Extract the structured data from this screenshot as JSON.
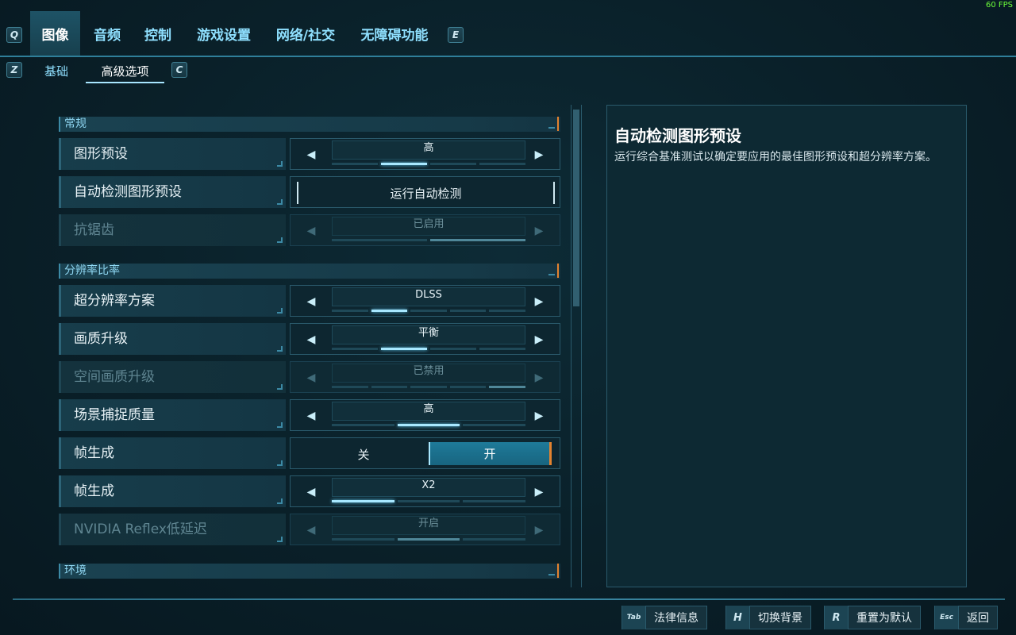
{
  "fps": "60 FPS",
  "top_tabs": {
    "left_key": "Q",
    "right_key": "E",
    "items": [
      "图像",
      "音频",
      "控制",
      "游戏设置",
      "网络/社交",
      "无障碍功能"
    ]
  },
  "sub_tabs": {
    "left_key": "Z",
    "right_key": "C",
    "items": [
      "基础",
      "高级选项"
    ]
  },
  "sections": {
    "general": "常规",
    "resolution": "分辨率比率",
    "environment": "环境"
  },
  "settings": {
    "graphics_preset": {
      "label": "图形预设",
      "value": "高"
    },
    "auto_detect": {
      "label": "自动检测图形预设",
      "button": "运行自动检测"
    },
    "anti_aliasing": {
      "label": "抗锯齿",
      "value": "已启用"
    },
    "upscaling_method": {
      "label": "超分辨率方案",
      "value": "DLSS"
    },
    "quality_upscaling": {
      "label": "画质升级",
      "value": "平衡"
    },
    "spatial_upscaling": {
      "label": "空间画质升级",
      "value": "已禁用"
    },
    "scene_capture": {
      "label": "场景捕捉质量",
      "value": "高"
    },
    "frame_gen_toggle": {
      "label": "帧生成",
      "off": "关",
      "on": "开"
    },
    "frame_gen_mult": {
      "label": "帧生成",
      "value": "X2"
    },
    "reflex": {
      "label": "NVIDIA Reflex低延迟",
      "value": "开启"
    }
  },
  "info_panel": {
    "title": "自动检测图形预设",
    "description": "运行综合基准测试以确定要应用的最佳图形预设和超分辨率方案。"
  },
  "bottom_bar": {
    "legal": {
      "key": "Tab",
      "label": "法律信息"
    },
    "bg": {
      "key": "H",
      "label": "切换背景"
    },
    "reset": {
      "key": "R",
      "label": "重置为默认"
    },
    "back": {
      "key": "Esc",
      "label": "返回"
    }
  },
  "colors": {
    "accent": "#a8e8ff",
    "orange": "#e3822f",
    "panel": "#0d2933"
  }
}
